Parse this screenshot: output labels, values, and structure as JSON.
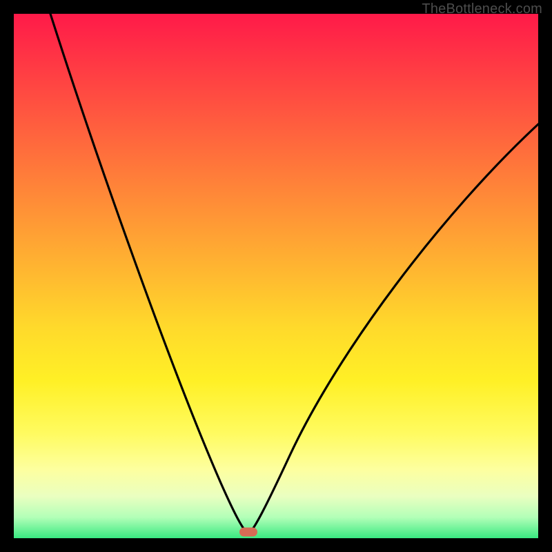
{
  "attribution": "TheBottleneck.com",
  "marker": {
    "x_pct": 44.7,
    "y_pct": 98.8
  },
  "chart_data": {
    "type": "line",
    "title": "",
    "xlabel": "",
    "ylabel": "",
    "xlim": [
      0,
      100
    ],
    "ylim": [
      0,
      100
    ],
    "series": [
      {
        "name": "left-branch",
        "x": [
          7,
          12,
          17,
          22,
          27,
          32,
          37,
          40,
          42,
          43.5,
          44.7
        ],
        "y": [
          100,
          86,
          73,
          60,
          47,
          35,
          23,
          14,
          8,
          3,
          0
        ]
      },
      {
        "name": "right-branch",
        "x": [
          44.7,
          46,
          48,
          51,
          55,
          60,
          66,
          73,
          81,
          90,
          100
        ],
        "y": [
          0,
          3,
          8,
          15,
          24,
          33,
          43,
          53,
          62,
          71,
          79
        ]
      }
    ],
    "annotations": [
      {
        "type": "marker",
        "shape": "pill",
        "color": "#d66c55",
        "x": 44.7,
        "y": 0
      }
    ],
    "background": {
      "type": "vertical-gradient",
      "stops": [
        {
          "pct": 0,
          "color": "#ff1a49"
        },
        {
          "pct": 50,
          "color": "#ffba30"
        },
        {
          "pct": 80,
          "color": "#fffb60"
        },
        {
          "pct": 100,
          "color": "#39e981"
        }
      ]
    }
  }
}
